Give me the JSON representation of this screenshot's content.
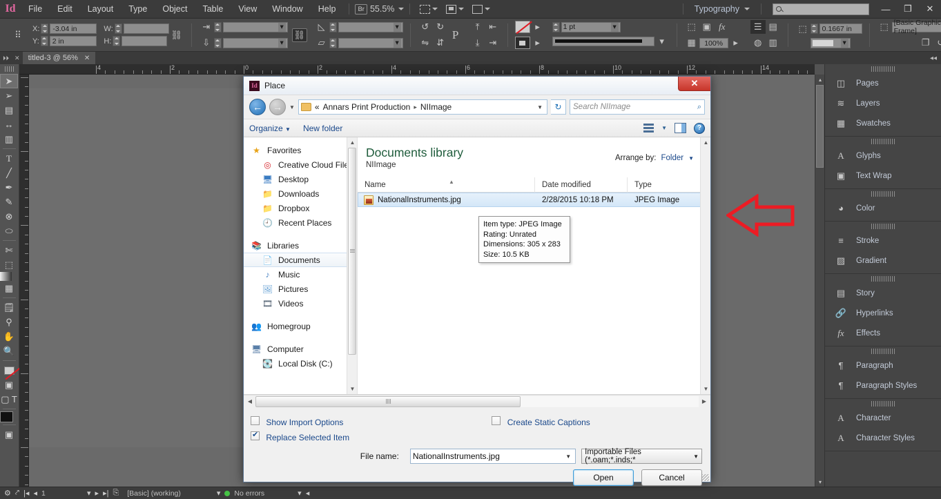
{
  "app": {
    "logo": "Id",
    "menu": [
      "File",
      "Edit",
      "Layout",
      "Type",
      "Object",
      "Table",
      "View",
      "Window",
      "Help"
    ],
    "bridge_label": "Br",
    "zoom_level": "55.5%",
    "workspace": "Typography",
    "search_placeholder": "",
    "window_buttons": {
      "minimize": "—",
      "restore": "❐",
      "close": "✕"
    }
  },
  "control_bar": {
    "x_label": "X:",
    "x_value": "-3.04 in",
    "y_label": "Y:",
    "y_value": "2 in",
    "w_label": "W:",
    "w_value": "",
    "h_label": "H:",
    "h_value": "",
    "stroke_weight": "1 pt",
    "opacity": "100%",
    "text_wrap_offset": "0.1667 in",
    "object_style": "[Basic Graphics Frame]",
    "proxy_icon": "reference-point-proxy",
    "constrain_icon": "link-chain",
    "shear_icon": "shear-angle",
    "rotate_icon": "rotation-angle"
  },
  "tab_bar": {
    "document_tab": "titled-3 @ 56%",
    "close_glyph": "✕"
  },
  "toolbox": [
    "selection-tool",
    "direct-selection-tool",
    "page-tool",
    "gap-tool",
    "content-collector-tool",
    "type-tool",
    "line-tool",
    "pen-tool",
    "pencil-tool",
    "ellipse-frame-tool",
    "ellipse-tool",
    "scissors-tool",
    "free-transform-tool",
    "gradient-swatch-tool",
    "gradient-feather-tool",
    "note-tool",
    "eyedropper-tool",
    "hand-tool",
    "zoom-tool",
    "fill-stroke-control",
    "formatting-affects-container",
    "apply-color",
    "apply-none",
    "normal-view-mode",
    "preview-mode"
  ],
  "ruler": {
    "horizontal_ticks": [
      "4",
      "2",
      "0",
      "2",
      "4",
      "6",
      "8",
      "10",
      "12",
      "14"
    ],
    "unit": "in"
  },
  "annotation": {
    "arrow": "red-left-arrow"
  },
  "dock": {
    "groups": [
      {
        "items": [
          {
            "label": "Pages",
            "icon": "pages-icon"
          },
          {
            "label": "Layers",
            "icon": "layers-icon"
          },
          {
            "label": "Swatches",
            "icon": "swatches-icon"
          }
        ]
      },
      {
        "items": [
          {
            "label": "Glyphs",
            "icon": "glyphs-icon"
          },
          {
            "label": "Text Wrap",
            "icon": "text-wrap-icon"
          }
        ]
      },
      {
        "items": [
          {
            "label": "Color",
            "icon": "color-palette-icon"
          }
        ]
      },
      {
        "items": [
          {
            "label": "Stroke",
            "icon": "stroke-icon"
          },
          {
            "label": "Gradient",
            "icon": "gradient-icon"
          }
        ]
      },
      {
        "items": [
          {
            "label": "Story",
            "icon": "story-icon"
          },
          {
            "label": "Hyperlinks",
            "icon": "hyperlinks-icon"
          },
          {
            "label": "Effects",
            "icon": "effects-fx-icon"
          }
        ]
      },
      {
        "items": [
          {
            "label": "Paragraph",
            "icon": "paragraph-icon"
          },
          {
            "label": "Paragraph Styles",
            "icon": "paragraph-styles-icon"
          }
        ]
      },
      {
        "items": [
          {
            "label": "Character",
            "icon": "character-icon"
          },
          {
            "label": "Character Styles",
            "icon": "character-styles-icon"
          }
        ]
      }
    ]
  },
  "status_bar": {
    "page_number": "1",
    "preflight_profile": "[Basic] (working)",
    "errors": "No errors"
  },
  "dialog": {
    "title": "Place",
    "close_glyph": "✕",
    "breadcrumb": {
      "prefix": "«",
      "parts": [
        "Annars Print Production",
        "NIImage"
      ],
      "separator": "▸"
    },
    "search_placeholder": "Search NIImage",
    "toolbar": {
      "organize": "Organize",
      "new_folder": "New folder"
    },
    "sidebar": [
      {
        "label": "Favorites",
        "icon": "star-icon",
        "indent": false,
        "selected": false
      },
      {
        "label": "Creative Cloud Files",
        "icon": "creative-cloud-icon",
        "indent": true,
        "selected": false
      },
      {
        "label": "Desktop",
        "icon": "desktop-icon",
        "indent": true,
        "selected": false
      },
      {
        "label": "Downloads",
        "icon": "downloads-folder-icon",
        "indent": true,
        "selected": false
      },
      {
        "label": "Dropbox",
        "icon": "dropbox-folder-icon",
        "indent": true,
        "selected": false
      },
      {
        "label": "Recent Places",
        "icon": "recent-places-icon",
        "indent": true,
        "selected": false
      },
      {
        "label": "Libraries",
        "icon": "libraries-icon",
        "indent": false,
        "selected": false,
        "gap_before": true
      },
      {
        "label": "Documents",
        "icon": "documents-icon",
        "indent": true,
        "selected": true
      },
      {
        "label": "Music",
        "icon": "music-icon",
        "indent": true,
        "selected": false
      },
      {
        "label": "Pictures",
        "icon": "pictures-icon",
        "indent": true,
        "selected": false
      },
      {
        "label": "Videos",
        "icon": "videos-icon",
        "indent": true,
        "selected": false
      },
      {
        "label": "Homegroup",
        "icon": "homegroup-icon",
        "indent": false,
        "selected": false,
        "gap_before": true
      },
      {
        "label": "Computer",
        "icon": "computer-icon",
        "indent": false,
        "selected": false,
        "gap_before": true
      },
      {
        "label": "Local Disk (C:)",
        "icon": "local-disk-icon",
        "indent": true,
        "selected": false
      }
    ],
    "library": {
      "title": "Documents library",
      "subtitle": "NIImage",
      "arrange_label": "Arrange by:",
      "arrange_value": "Folder"
    },
    "columns": [
      "Name",
      "Date modified",
      "Type"
    ],
    "files": [
      {
        "name": "NationalInstruments.jpg",
        "date": "2/28/2015 10:18 PM",
        "type": "JPEG Image",
        "selected": true,
        "icon": "jpeg-file-icon"
      }
    ],
    "tooltip": {
      "item_type": "Item type: JPEG Image",
      "rating": "Rating: Unrated",
      "dimensions": "Dimensions: 305 x 283",
      "size": "Size: 10.5 KB"
    },
    "options": [
      {
        "label": "Show Import Options",
        "checked": false
      },
      {
        "label": "Create Static Captions",
        "checked": false
      },
      {
        "label": "Replace Selected Item",
        "checked": true
      }
    ],
    "file_name_label": "File name:",
    "file_name_value": "NationalInstruments.jpg",
    "filter_value": "Importable Files (*.oam;*.inds;*",
    "buttons": {
      "open": "Open",
      "cancel": "Cancel"
    }
  }
}
